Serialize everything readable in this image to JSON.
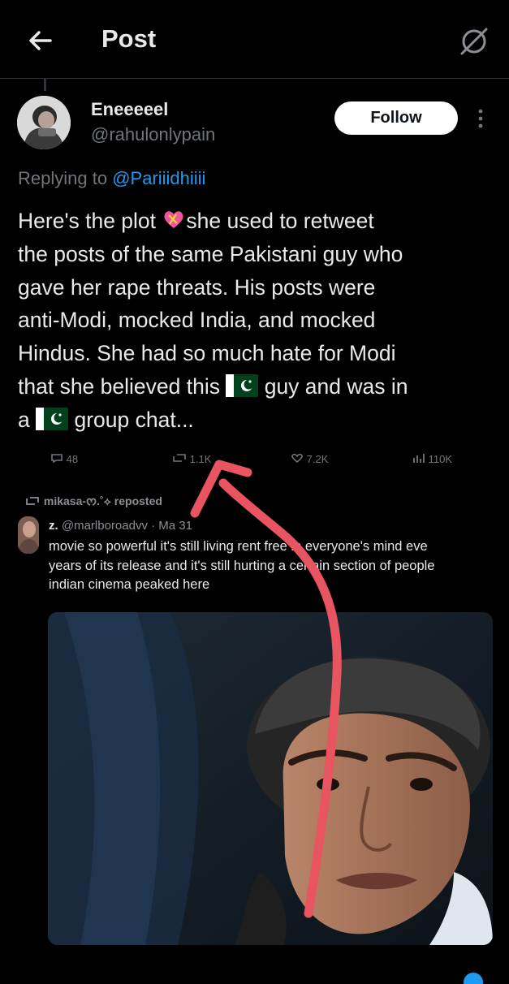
{
  "header": {
    "title": "Post"
  },
  "author": {
    "name": "Eneeeeel",
    "handle": "@rahulonlypain",
    "follow_label": "Follow"
  },
  "reply": {
    "prefix": "Replying to ",
    "to": "@Pariiidhiiii"
  },
  "post": {
    "line1_a": "Here's the plot ",
    "line1_b": "she used to retweet",
    "line2": "the posts of the same Pakistani guy who",
    "line3": "gave her rape threats. His posts were",
    "line4": "anti-Modi, mocked India, and mocked",
    "line5": "Hindus. She had so much hate for Modi",
    "line6_a": "that she believed this ",
    "line6_b": " guy and was in",
    "line7_a": "a ",
    "line7_b": " group chat..."
  },
  "screenshot": {
    "stats": [
      "48",
      "1.1K",
      "7.2K",
      "110K"
    ],
    "repost_by": "mikasa-ᰔ.˚⟡ reposted",
    "quoted_name": "z.",
    "quoted_handle": "@marlboroadvv · Ma 31",
    "quoted_lines": [
      "movie so powerful it's still living rent free in everyone's mind eve",
      "years of its release and it's still hurting a certain section of people",
      "indian cinema peaked here"
    ]
  },
  "colors": {
    "link": "#1d9bf0",
    "annotation_arrow": "#e8545f",
    "follow_bg": "#ffffff"
  },
  "icons": [
    "back-arrow-icon",
    "grok-icon",
    "more-icon",
    "pakistan-flag-icon",
    "sparkling-heart-icon",
    "repost-icon",
    "reply-icon",
    "like-icon",
    "views-icon",
    "red-annotation-arrow"
  ]
}
